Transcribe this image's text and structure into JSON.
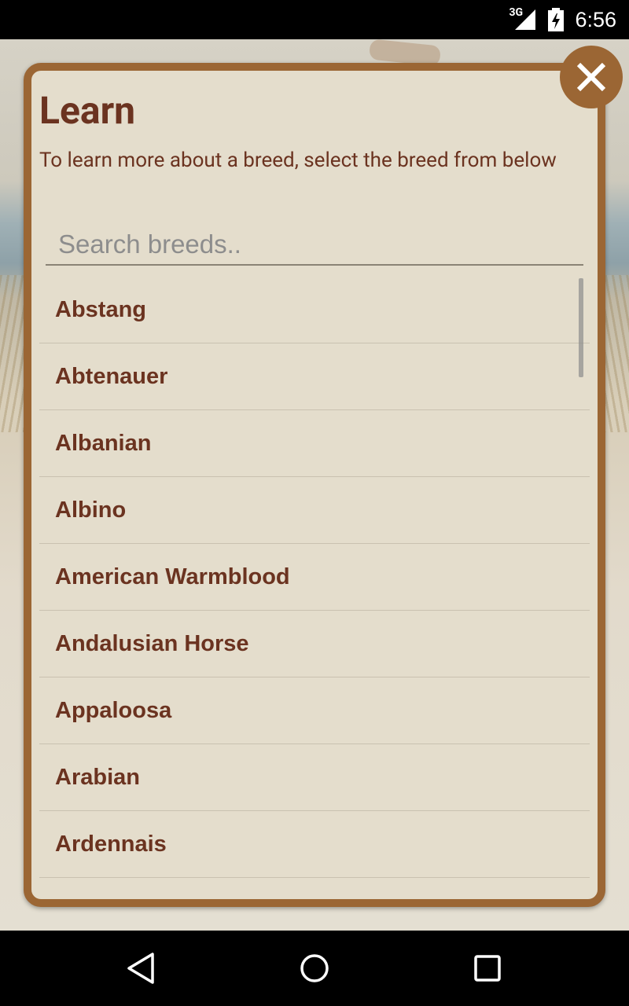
{
  "status_bar": {
    "network": "3G",
    "time": "6:56"
  },
  "dialog": {
    "title": "Learn",
    "description": "To learn more about a breed, select the breed from below",
    "search_placeholder": "Search breeds..",
    "breeds": [
      "Abstang",
      "Abtenauer",
      "Albanian",
      "Albino",
      "American Warmblood",
      "Andalusian Horse",
      "Appaloosa",
      "Arabian",
      "Ardennais"
    ]
  },
  "icons": {
    "close": "close-icon",
    "back": "back-icon",
    "home": "home-icon",
    "recents": "recents-icon"
  },
  "colors": {
    "accent": "#9b6634",
    "text": "#6b3320",
    "panel": "#e4ddcc"
  }
}
